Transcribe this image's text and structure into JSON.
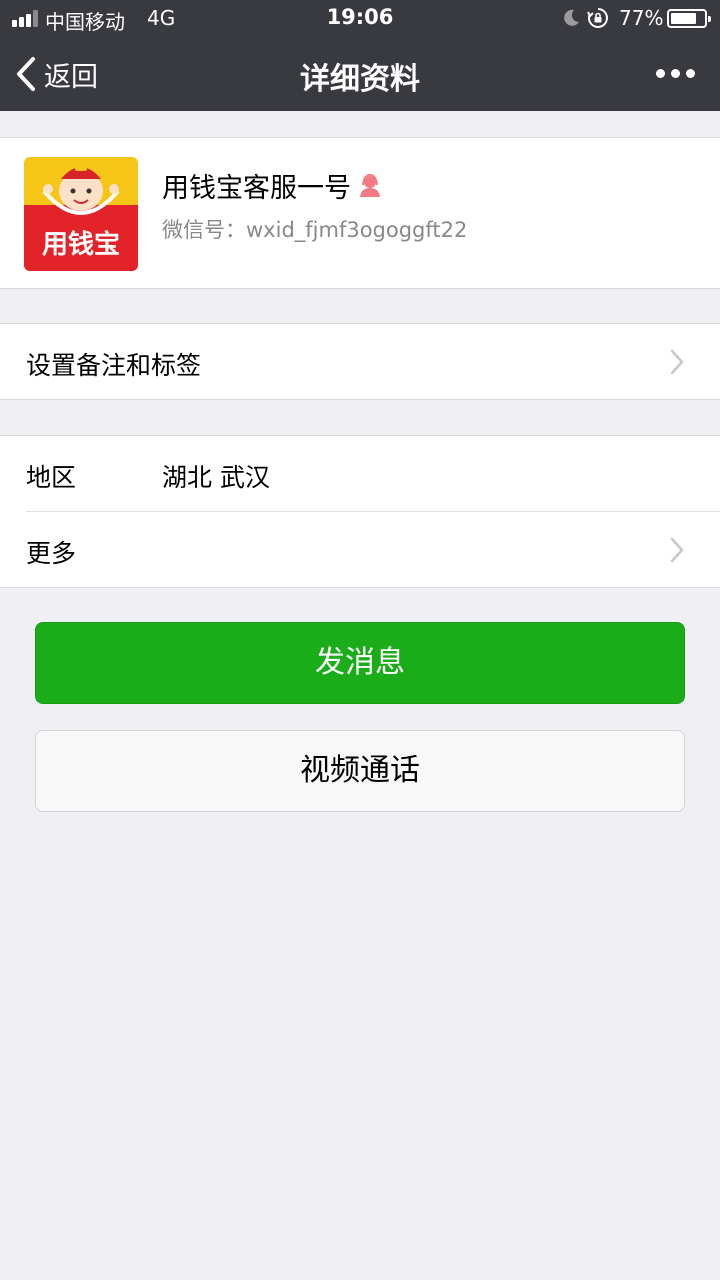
{
  "status_bar": {
    "carrier": "中国移动",
    "network": "4G",
    "time": "19:06",
    "battery_percent": "77%",
    "battery_level": 0.77,
    "signal_bars": 3
  },
  "nav": {
    "back_label": "返回",
    "title": "详细资料",
    "more_icon": "more-dots-icon"
  },
  "profile": {
    "name": "用钱宝客服一号",
    "gender_icon": "female-icon",
    "wxid_label": "微信号：",
    "wxid": "wxid_fjmf3ogoggft22",
    "avatar_text": "用钱宝"
  },
  "rows": {
    "remark": {
      "label": "设置备注和标签"
    },
    "region": {
      "label": "地区",
      "value": "湖北 武汉"
    },
    "more": {
      "label": "更多"
    }
  },
  "buttons": {
    "send_message": "发消息",
    "video_call": "视频通话"
  },
  "colors": {
    "nav_bg": "#393a3f",
    "page_bg": "#efeff4",
    "primary_green": "#1aad19",
    "gender_pink": "#f37b84"
  }
}
